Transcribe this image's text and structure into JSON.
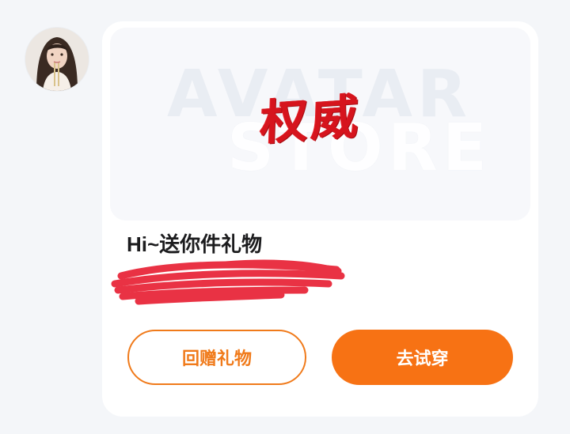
{
  "sender": {
    "avatar_icon": "user-avatar-photo"
  },
  "gift_card": {
    "banner": {
      "watermark_line1": "AVATAR",
      "watermark_line2": "STORE",
      "item_title": "权威",
      "item_title_color": "#d6141d"
    },
    "greeting": "Hi~送你件礼物",
    "redacted_color": "#e8283a"
  },
  "actions": {
    "return_gift_label": "回赠礼物",
    "try_on_label": "去试穿",
    "accent_color": "#f77214"
  }
}
